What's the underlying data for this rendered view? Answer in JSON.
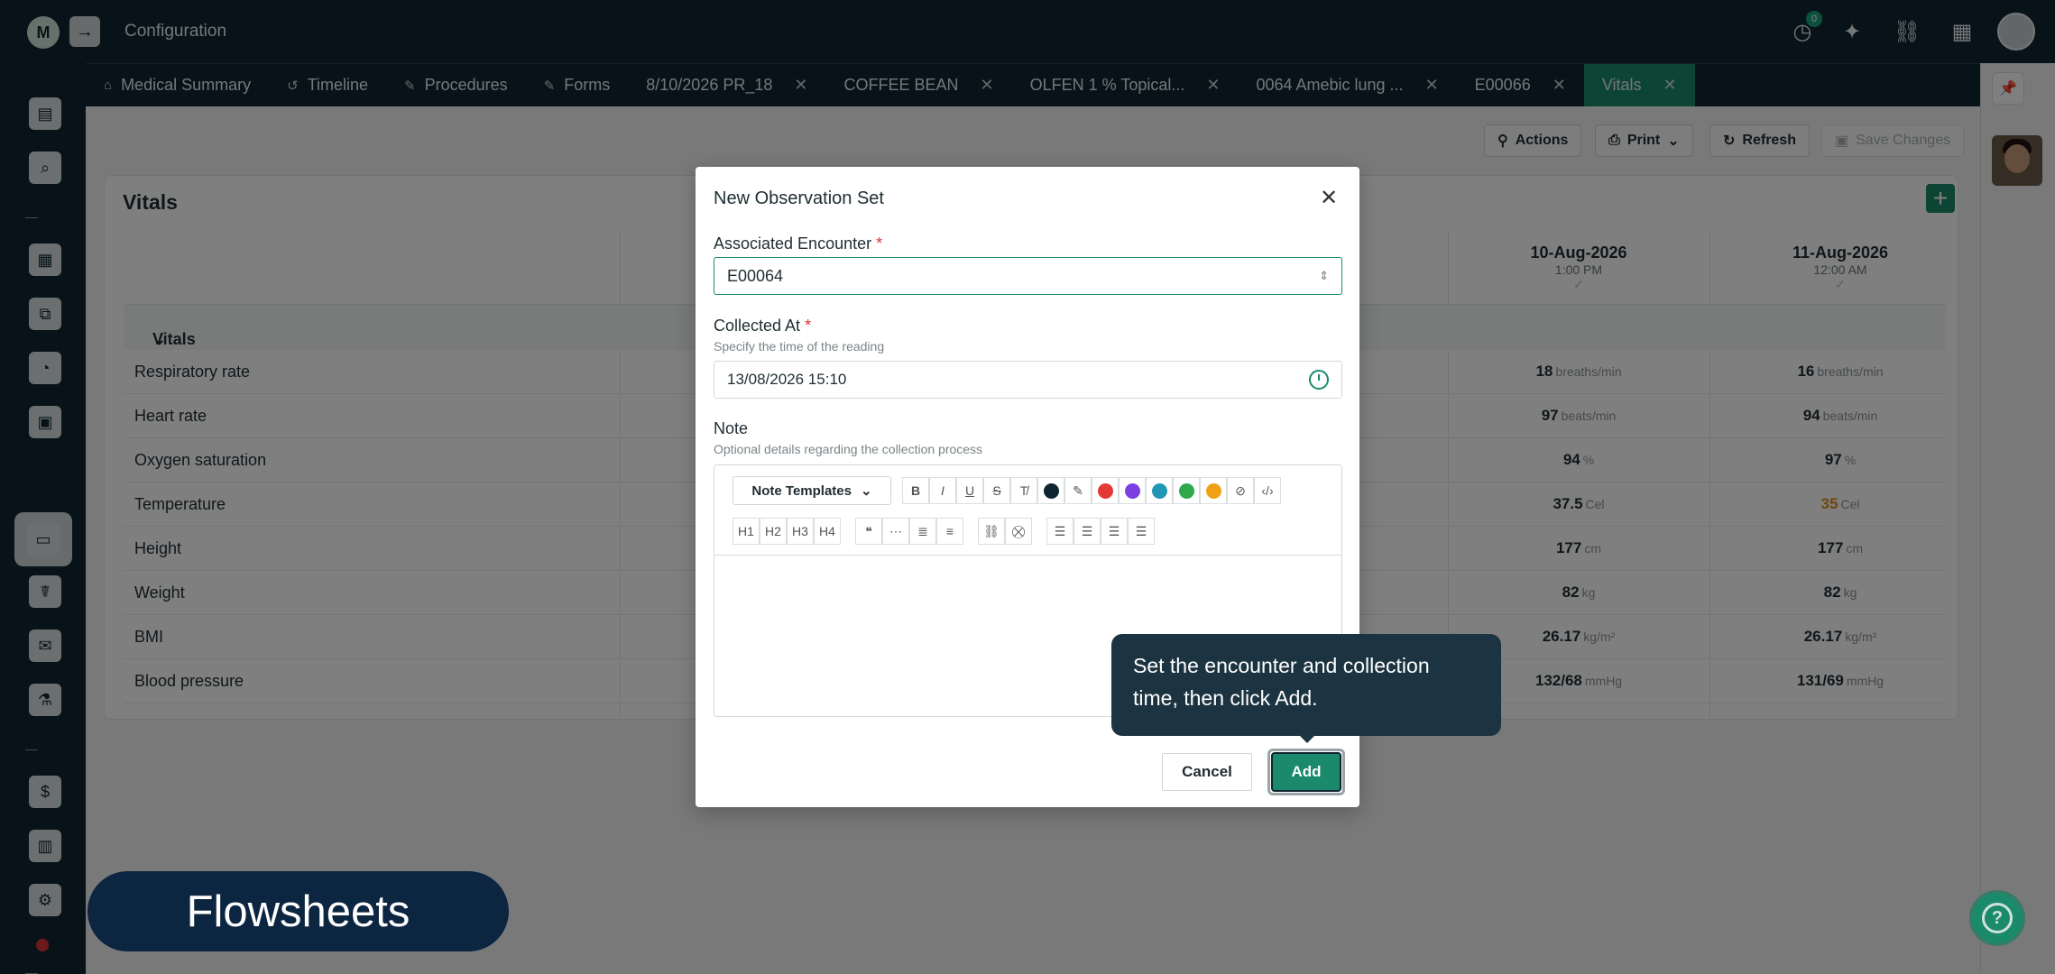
{
  "app": {
    "title": "Configuration",
    "logo": "app-logo",
    "notification_count": "0"
  },
  "tabs": [
    {
      "label": "Medical Summary",
      "icon": "home-icon",
      "closable": false
    },
    {
      "label": "Timeline",
      "icon": "history-icon",
      "closable": false
    },
    {
      "label": "Procedures",
      "icon": "pencil-icon",
      "closable": false
    },
    {
      "label": "Forms",
      "icon": "pencil-icon",
      "closable": false
    },
    {
      "label": "8/10/2026 PR_18",
      "closable": true
    },
    {
      "label": "COFFEE BEAN",
      "closable": true
    },
    {
      "label": "OLFEN 1 % Topical...",
      "closable": true
    },
    {
      "label": "0064 Amebic lung ...",
      "closable": true
    },
    {
      "label": "E00066",
      "closable": true
    },
    {
      "label": "Vitals",
      "closable": true,
      "active": true
    }
  ],
  "toolbar": {
    "actions": "Actions",
    "print": "Print",
    "refresh": "Refresh",
    "save": "Save Changes"
  },
  "vitals": {
    "title": "Vitals",
    "section": "Vitals",
    "columns": [
      {
        "date": "10-Aug-2026",
        "time": "1:00 PM"
      },
      {
        "date": "11-Aug-2026",
        "time": "12:00 AM"
      }
    ],
    "rows": [
      {
        "label": "Respiratory rate",
        "values": [
          {
            "v": "18",
            "u": "breaths/min"
          },
          {
            "v": "16",
            "u": "breaths/min"
          }
        ]
      },
      {
        "label": "Heart rate",
        "values": [
          {
            "v": "97",
            "u": "beats/min"
          },
          {
            "v": "94",
            "u": "beats/min"
          }
        ]
      },
      {
        "label": "Oxygen saturation",
        "values": [
          {
            "v": "94",
            "u": "%"
          },
          {
            "v": "97",
            "u": "%"
          }
        ]
      },
      {
        "label": "Temperature",
        "values": [
          {
            "v": "37.5",
            "u": "Cel"
          },
          {
            "v": "35",
            "u": "Cel",
            "warn": true
          }
        ]
      },
      {
        "label": "Height",
        "values": [
          {
            "v": "177",
            "u": "cm"
          },
          {
            "v": "177",
            "u": "cm"
          }
        ]
      },
      {
        "label": "Weight",
        "values": [
          {
            "v": "82",
            "u": "kg"
          },
          {
            "v": "82",
            "u": "kg"
          }
        ]
      },
      {
        "label": "BMI",
        "values": [
          {
            "v": "26.17",
            "u": "kg/m²"
          },
          {
            "v": "26.17",
            "u": "kg/m²"
          }
        ]
      },
      {
        "label": "Blood pressure",
        "values": [
          {
            "v": "132/68",
            "u": "mmHg"
          },
          {
            "v": "131/69",
            "u": "mmHg"
          }
        ]
      }
    ]
  },
  "modal": {
    "title": "New Observation Set",
    "encounter_label": "Associated Encounter",
    "encounter_value": "E00064",
    "collected_label": "Collected At",
    "collected_help": "Specify the time of the reading",
    "collected_value": "13/08/2026 15:10",
    "note_label": "Note",
    "note_help": "Optional details regarding the collection process",
    "templates": "Note Templates",
    "required_mark": "*",
    "cancel": "Cancel",
    "add": "Add",
    "text_colors": [
      "#0f2630",
      "#e53935",
      "#7b3fe4",
      "#1f97b5",
      "#2ea84a",
      "#f0a015"
    ]
  },
  "tooltip": {
    "text": "Set the encounter and collection time, then click Add."
  },
  "caption": "Flowsheets",
  "colors": {
    "primary": "#1b8a6b",
    "navy": "#0f2630",
    "warning": "#e08a1e"
  }
}
